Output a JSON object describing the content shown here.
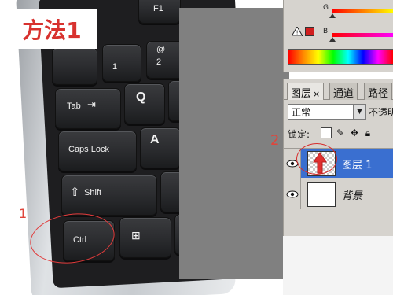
{
  "badge": {
    "method": "方法1"
  },
  "keyboard": {
    "keys": {
      "f1": "F1",
      "one": "1",
      "at": "@",
      "two": "2",
      "tab": "Tab",
      "q": "Q",
      "caps": "Caps Lock",
      "a": "A",
      "shift": "Shift",
      "ctrl": "Ctrl"
    }
  },
  "annotations": {
    "num_1": "1",
    "num_2": "2"
  },
  "color_panel": {
    "slider_g": "G",
    "slider_b": "B",
    "swatch_color": "#d11e1e"
  },
  "layers_panel": {
    "tabs": [
      {
        "label": "图层",
        "close": "×"
      },
      {
        "label": "通道"
      },
      {
        "label": "路径"
      }
    ],
    "blend_mode": "正常",
    "opacity_label": "不透明",
    "lock_label": "锁定:",
    "layers": [
      {
        "name": "图层 1",
        "selected": true
      },
      {
        "name": "背景",
        "selected": false
      }
    ]
  },
  "colors": {
    "annotation_red": "#e0453b",
    "selection_blue": "#3a6fd0"
  }
}
